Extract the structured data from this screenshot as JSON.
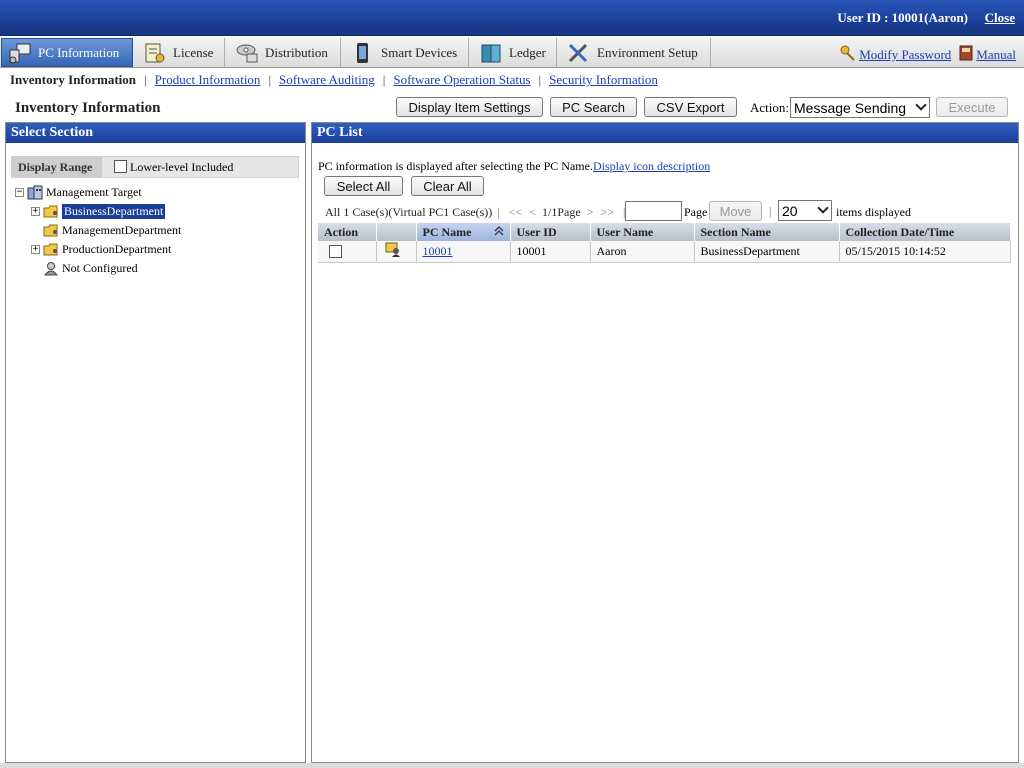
{
  "header": {
    "user_id_text": "User ID : 10001(Aaron)",
    "close_label": "Close"
  },
  "tabs": [
    {
      "label": "PC Information",
      "icon": "pc-icon",
      "active": true
    },
    {
      "label": "License",
      "icon": "license-icon"
    },
    {
      "label": "Distribution",
      "icon": "distribution-icon"
    },
    {
      "label": "Smart Devices",
      "icon": "smart-device-icon"
    },
    {
      "label": "Ledger",
      "icon": "ledger-icon"
    },
    {
      "label": "Environment Setup",
      "icon": "tools-icon"
    }
  ],
  "right_links": {
    "modify_password": "Modify Password",
    "manual": "Manual"
  },
  "subnav": {
    "current": "Inventory Information",
    "links": [
      "Product Information",
      "Software Auditing",
      "Software Operation Status",
      "Security Information"
    ]
  },
  "toolbar": {
    "page_title": "Inventory Information",
    "display_item_settings": "Display Item Settings",
    "pc_search": "PC Search",
    "csv_export": "CSV Export",
    "action_label": "Action:",
    "action_value": "Message Sending",
    "execute": "Execute"
  },
  "left_panel": {
    "title": "Select Section",
    "display_range": "Display Range",
    "lower_level": "Lower-level Included",
    "tree": {
      "root": "Management Target",
      "children": [
        "BusinessDepartment",
        "ManagementDepartment",
        "ProductionDepartment",
        "Not Configured"
      ]
    }
  },
  "right_panel": {
    "title": "PC List",
    "info_text": "PC information is displayed after selecting the PC Name.",
    "icon_desc_link": "Display icon description",
    "select_all": "Select All",
    "clear_all": "Clear All",
    "pager": {
      "count_text": "All 1 Case(s)(Virtual PC1 Case(s))",
      "first": "<<",
      "prev": "<",
      "page_info": "1/1Page",
      "next": ">",
      "last": ">>",
      "page_label": "Page",
      "move": "Move",
      "per_page": "20",
      "items_displayed": "items displayed"
    },
    "columns": [
      "Action",
      "",
      "PC Name",
      "User ID",
      "User Name",
      "Section Name",
      "Collection Date/Time"
    ],
    "rows": [
      {
        "pc_name": "10001",
        "user_id": "10001",
        "user_name": "Aaron",
        "section": "BusinessDepartment",
        "collected": "05/15/2015 10:14:52"
      }
    ]
  }
}
